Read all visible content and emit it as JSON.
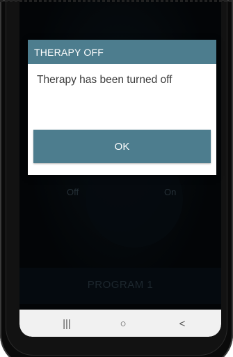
{
  "dialog": {
    "title": "THERAPY OFF",
    "message": "Therapy has been turned off",
    "ok_label": "OK"
  },
  "background_app": {
    "off_label": "Off",
    "on_label": "On",
    "program_label": "PROGRAM 1"
  },
  "navigation": {
    "recents_icon": "|||",
    "home_icon": "○",
    "back_icon": "<"
  },
  "colors": {
    "accent": "#4d7d8e",
    "screen_bg": "#05080b",
    "navbar_bg": "#f1f1f1"
  }
}
